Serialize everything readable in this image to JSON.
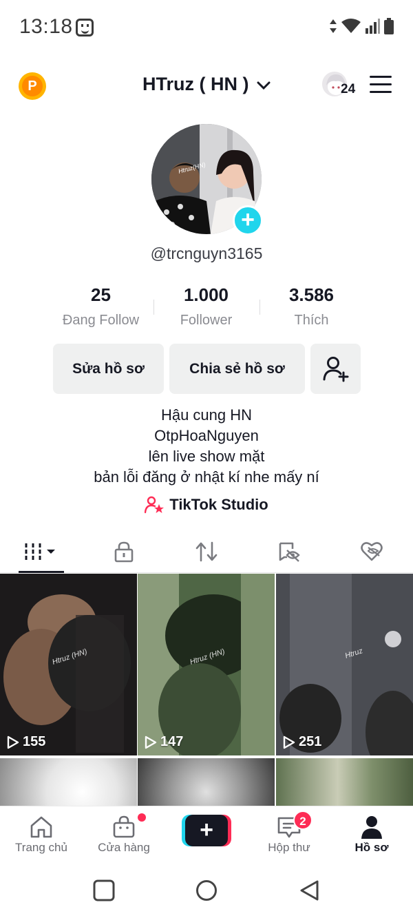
{
  "status_bar": {
    "time": "13:18",
    "icons": [
      "smiley-notification-icon",
      "data-arrows-icon",
      "wifi-icon",
      "signal-icon",
      "battery-icon"
    ]
  },
  "header": {
    "username": "HTruz ( HN )",
    "friends_count": "24",
    "coin_label": "P"
  },
  "profile": {
    "handle": "@trcnguyn3165",
    "stats": [
      {
        "value": "25",
        "label": "Đang Follow"
      },
      {
        "value": "1.000",
        "label": "Follower"
      },
      {
        "value": "3.586",
        "label": "Thích"
      }
    ],
    "buttons": {
      "edit": "Sửa hồ sơ",
      "share": "Chia sẻ hồ sơ"
    },
    "bio": [
      "Hậu cung HN",
      "OtpHoaNguyen",
      "lên live show mặt",
      "bản lỗi đăng ở nhật kí nhe mấy ní"
    ],
    "studio_link": "TikTok Studio"
  },
  "tabs": [
    "videos-grid-icon",
    "private-lock-icon",
    "repost-icon",
    "hidden-eye-icon",
    "liked-heart-icon"
  ],
  "videos": [
    {
      "views": "155",
      "watermark": "Htruz (HN)"
    },
    {
      "views": "147",
      "watermark": "Htruz (HN)"
    },
    {
      "views": "251",
      "watermark": "Htruz"
    }
  ],
  "bottom_nav": {
    "home": "Trang chủ",
    "shop": "Cửa hàng",
    "inbox": "Hộp thư",
    "inbox_badge": "2",
    "profile": "Hồ sơ"
  },
  "colors": {
    "accent_red": "#fe2c55",
    "accent_cyan": "#20d5ec",
    "text": "#161823",
    "muted": "#8a8b91"
  }
}
